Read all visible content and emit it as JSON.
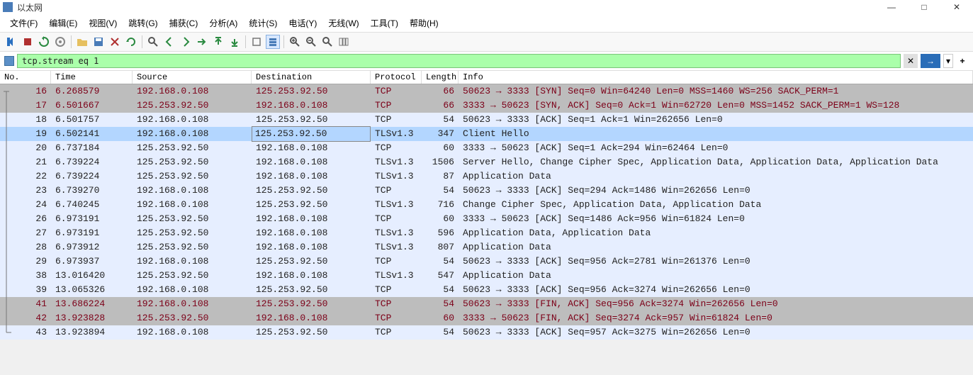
{
  "window": {
    "title": "以太网",
    "min": "—",
    "max": "□",
    "close": "✕"
  },
  "menu": [
    "文件(F)",
    "编辑(E)",
    "视图(V)",
    "跳转(G)",
    "捕获(C)",
    "分析(A)",
    "统计(S)",
    "电话(Y)",
    "无线(W)",
    "工具(T)",
    "帮助(H)"
  ],
  "filter": {
    "value": "tcp.stream eq 1",
    "close": "✕",
    "apply": "→",
    "dd": "▾",
    "plus": "+"
  },
  "columns": {
    "no": "No.",
    "time": "Time",
    "source": "Source",
    "destination": "Destination",
    "protocol": "Protocol",
    "length": "Length",
    "info": "Info"
  },
  "rows": [
    {
      "no": "16",
      "time": "6.268579",
      "src": "192.168.0.108",
      "dst": "125.253.92.50",
      "proto": "TCP",
      "len": "66",
      "info": "50623 → 3333 [SYN] Seq=0 Win=64240 Len=0 MSS=1460 WS=256 SACK_PERM=1",
      "bg": "#bdbdbd",
      "fg": "#7c0018",
      "conn": "first"
    },
    {
      "no": "17",
      "time": "6.501667",
      "src": "125.253.92.50",
      "dst": "192.168.0.108",
      "proto": "TCP",
      "len": "66",
      "info": "3333 → 50623 [SYN, ACK] Seq=0 Ack=1 Win=62720 Len=0 MSS=1452 SACK_PERM=1 WS=128",
      "bg": "#bdbdbd",
      "fg": "#7c0018",
      "conn": "mid"
    },
    {
      "no": "18",
      "time": "6.501757",
      "src": "192.168.0.108",
      "dst": "125.253.92.50",
      "proto": "TCP",
      "len": "54",
      "info": "50623 → 3333 [ACK] Seq=1 Ack=1 Win=262656 Len=0",
      "bg": "#e6eeff",
      "fg": "#222",
      "conn": "mid"
    },
    {
      "no": "19",
      "time": "6.502141",
      "src": "192.168.0.108",
      "dst": "125.253.92.50",
      "proto": "TLSv1.3",
      "len": "347",
      "info": "Client Hello",
      "bg": "#b3d6ff",
      "fg": "#222",
      "conn": "mid",
      "dstFramed": true
    },
    {
      "no": "20",
      "time": "6.737184",
      "src": "125.253.92.50",
      "dst": "192.168.0.108",
      "proto": "TCP",
      "len": "60",
      "info": "3333 → 50623 [ACK] Seq=1 Ack=294 Win=62464 Len=0",
      "bg": "#e6eeff",
      "fg": "#222",
      "conn": "mid"
    },
    {
      "no": "21",
      "time": "6.739224",
      "src": "125.253.92.50",
      "dst": "192.168.0.108",
      "proto": "TLSv1.3",
      "len": "1506",
      "info": "Server Hello, Change Cipher Spec, Application Data, Application Data, Application Data",
      "bg": "#e6eeff",
      "fg": "#222",
      "conn": "mid"
    },
    {
      "no": "22",
      "time": "6.739224",
      "src": "125.253.92.50",
      "dst": "192.168.0.108",
      "proto": "TLSv1.3",
      "len": "87",
      "info": "Application Data",
      "bg": "#e6eeff",
      "fg": "#222",
      "conn": "mid"
    },
    {
      "no": "23",
      "time": "6.739270",
      "src": "192.168.0.108",
      "dst": "125.253.92.50",
      "proto": "TCP",
      "len": "54",
      "info": "50623 → 3333 [ACK] Seq=294 Ack=1486 Win=262656 Len=0",
      "bg": "#e6eeff",
      "fg": "#222",
      "conn": "mid"
    },
    {
      "no": "24",
      "time": "6.740245",
      "src": "192.168.0.108",
      "dst": "125.253.92.50",
      "proto": "TLSv1.3",
      "len": "716",
      "info": "Change Cipher Spec, Application Data, Application Data",
      "bg": "#e6eeff",
      "fg": "#222",
      "conn": "mid"
    },
    {
      "no": "26",
      "time": "6.973191",
      "src": "125.253.92.50",
      "dst": "192.168.0.108",
      "proto": "TCP",
      "len": "60",
      "info": "3333 → 50623 [ACK] Seq=1486 Ack=956 Win=61824 Len=0",
      "bg": "#e6eeff",
      "fg": "#222",
      "conn": "mid"
    },
    {
      "no": "27",
      "time": "6.973191",
      "src": "125.253.92.50",
      "dst": "192.168.0.108",
      "proto": "TLSv1.3",
      "len": "596",
      "info": "Application Data, Application Data",
      "bg": "#e6eeff",
      "fg": "#222",
      "conn": "mid"
    },
    {
      "no": "28",
      "time": "6.973912",
      "src": "125.253.92.50",
      "dst": "192.168.0.108",
      "proto": "TLSv1.3",
      "len": "807",
      "info": "Application Data",
      "bg": "#e6eeff",
      "fg": "#222",
      "conn": "mid"
    },
    {
      "no": "29",
      "time": "6.973937",
      "src": "192.168.0.108",
      "dst": "125.253.92.50",
      "proto": "TCP",
      "len": "54",
      "info": "50623 → 3333 [ACK] Seq=956 Ack=2781 Win=261376 Len=0",
      "bg": "#e6eeff",
      "fg": "#222",
      "conn": "mid"
    },
    {
      "no": "38",
      "time": "13.016420",
      "src": "125.253.92.50",
      "dst": "192.168.0.108",
      "proto": "TLSv1.3",
      "len": "547",
      "info": "Application Data",
      "bg": "#e6eeff",
      "fg": "#222",
      "conn": "mid"
    },
    {
      "no": "39",
      "time": "13.065326",
      "src": "192.168.0.108",
      "dst": "125.253.92.50",
      "proto": "TCP",
      "len": "54",
      "info": "50623 → 3333 [ACK] Seq=956 Ack=3274 Win=262656 Len=0",
      "bg": "#e6eeff",
      "fg": "#222",
      "conn": "mid"
    },
    {
      "no": "41",
      "time": "13.686224",
      "src": "192.168.0.108",
      "dst": "125.253.92.50",
      "proto": "TCP",
      "len": "54",
      "info": "50623 → 3333 [FIN, ACK] Seq=956 Ack=3274 Win=262656 Len=0",
      "bg": "#bdbdbd",
      "fg": "#7c0018",
      "conn": "mid"
    },
    {
      "no": "42",
      "time": "13.923828",
      "src": "125.253.92.50",
      "dst": "192.168.0.108",
      "proto": "TCP",
      "len": "60",
      "info": "3333 → 50623 [FIN, ACK] Seq=3274 Ack=957 Win=61824 Len=0",
      "bg": "#bdbdbd",
      "fg": "#7c0018",
      "conn": "mid"
    },
    {
      "no": "43",
      "time": "13.923894",
      "src": "192.168.0.108",
      "dst": "125.253.92.50",
      "proto": "TCP",
      "len": "54",
      "info": "50623 → 3333 [ACK] Seq=957 Ack=3275 Win=262656 Len=0",
      "bg": "#e6eeff",
      "fg": "#222",
      "conn": "last"
    }
  ]
}
